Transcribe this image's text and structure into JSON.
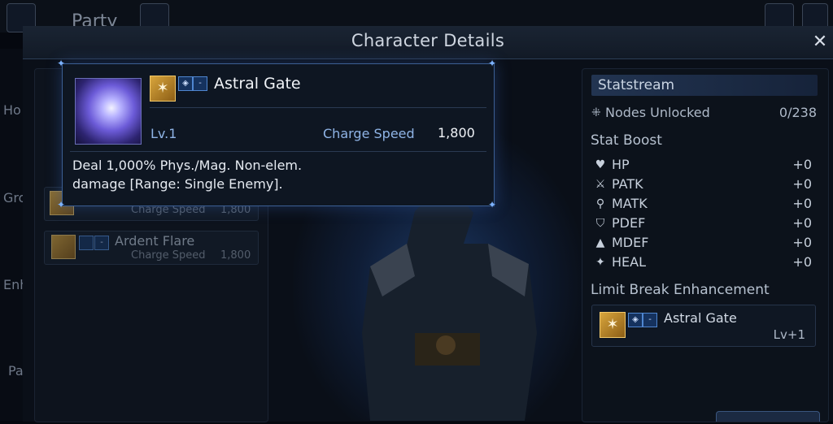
{
  "background": {
    "party_label": "Party",
    "nav_labels": [
      "Ho",
      "Gro",
      "Enh",
      "Pa"
    ]
  },
  "modal": {
    "title": "Character Details",
    "close_symbol": "✕"
  },
  "ability_list": [
    {
      "name": "",
      "charge_label": "Charge Speed",
      "charge_value": "1,800"
    },
    {
      "name": "Ardent Flare",
      "charge_label": "Charge Speed",
      "charge_value": "1,800"
    }
  ],
  "tooltip": {
    "ability_name": "Astral Gate",
    "level": "Lv.1",
    "charge_speed_label": "Charge Speed",
    "charge_speed_value": "1,800",
    "description": "Deal 1,000% Phys./Mag. Non-elem. damage [Range: Single Enemy].",
    "minus_symbol": "-"
  },
  "statstream": {
    "title": "Statstream",
    "nodes_label": "Nodes Unlocked",
    "nodes_value": "0/238",
    "stat_boost_title": "Stat Boost",
    "stats": [
      {
        "label": "HP",
        "value": "+0",
        "icon": "heart-icon"
      },
      {
        "label": "PATK",
        "value": "+0",
        "icon": "sword-icon"
      },
      {
        "label": "MATK",
        "value": "+0",
        "icon": "staff-icon"
      },
      {
        "label": "PDEF",
        "value": "+0",
        "icon": "shield-icon"
      },
      {
        "label": "MDEF",
        "value": "+0",
        "icon": "hat-icon"
      },
      {
        "label": "HEAL",
        "value": "+0",
        "icon": "sparkle-icon"
      }
    ],
    "limit_break_title": "Limit Break Enhancement",
    "limit_break_name": "Astral Gate",
    "limit_break_level": "Lv+1"
  },
  "colors": {
    "accent_blue": "#3b5f94",
    "gold_icon": "#d8a53c",
    "text_blue": "#8fb4e6"
  }
}
